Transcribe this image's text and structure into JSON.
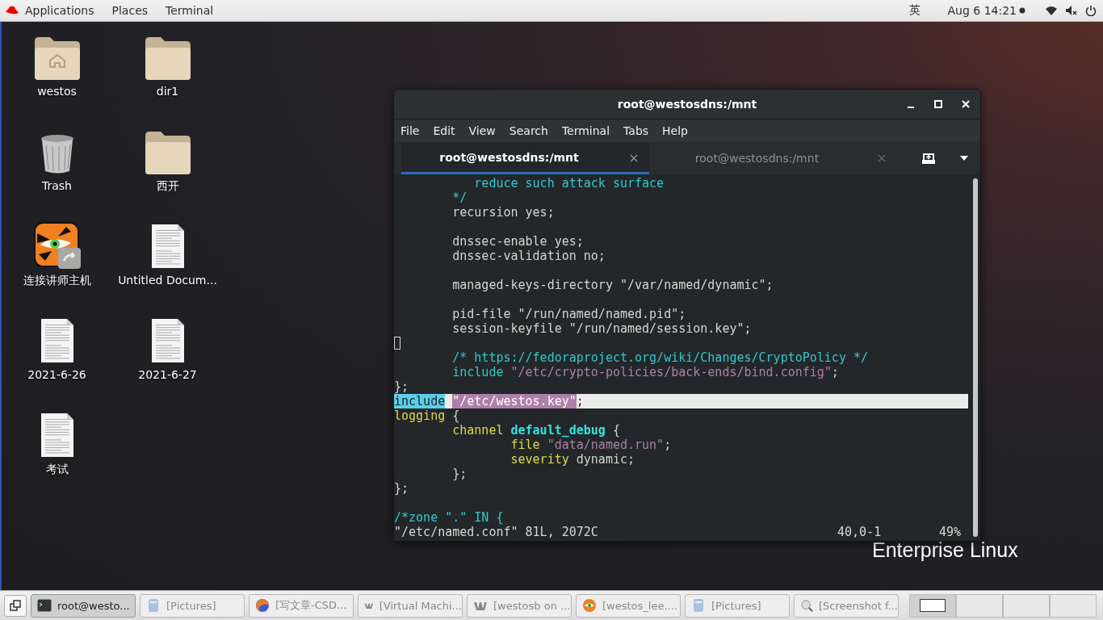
{
  "top_bar": {
    "menus": [
      {
        "label": "Applications"
      },
      {
        "label": "Places"
      },
      {
        "label": "Terminal"
      }
    ],
    "input_method": "英",
    "clock": "Aug 6  14:21"
  },
  "desktop": {
    "icons": [
      {
        "label": "westos",
        "kind": "home"
      },
      {
        "label": "dir1",
        "kind": "folder"
      },
      {
        "label": "Trash",
        "kind": "trash"
      },
      {
        "label": "西开",
        "kind": "folder"
      },
      {
        "label": "连接讲师主机",
        "kind": "app"
      },
      {
        "label": "Untitled Docum...",
        "kind": "document"
      },
      {
        "label": "2021-6-26",
        "kind": "document"
      },
      {
        "label": "2021-6-27",
        "kind": "document"
      },
      {
        "label": "考试",
        "kind": "document"
      }
    ],
    "wallpaper_text": "Enterprise Linux"
  },
  "window": {
    "title": "root@westosdns:/mnt",
    "menu": [
      "File",
      "Edit",
      "View",
      "Search",
      "Terminal",
      "Tabs",
      "Help"
    ],
    "tabs": [
      {
        "label": "root@westosdns:/mnt",
        "selected": true
      },
      {
        "label": "root@westosdns:/mnt",
        "selected": false
      }
    ],
    "lines": [
      {
        "segments": [
          {
            "text": "           reduce such attack surface",
            "kind": "comment"
          }
        ]
      },
      {
        "segments": [
          {
            "text": "        */",
            "kind": "comment"
          }
        ]
      },
      {
        "segments": [
          {
            "text": "        recursion yes;",
            "kind": "plain"
          }
        ]
      },
      {
        "kind": "blank"
      },
      {
        "segments": [
          {
            "text": "        dnssec-enable yes;",
            "kind": "plain"
          }
        ]
      },
      {
        "segments": [
          {
            "text": "        dnssec-validation no;",
            "kind": "plain"
          }
        ]
      },
      {
        "kind": "blank"
      },
      {
        "segments": [
          {
            "text": "        managed-keys-directory \"/var/named/dynamic\";",
            "kind": "plain"
          }
        ]
      },
      {
        "kind": "blank"
      },
      {
        "segments": [
          {
            "text": "        pid-file \"/run/named/named.pid\";",
            "kind": "plain"
          }
        ]
      },
      {
        "segments": [
          {
            "text": "        session-keyfile \"/run/named/session.key\";",
            "kind": "plain"
          }
        ]
      },
      {
        "kind": "cursor"
      },
      {
        "segments": [
          {
            "text": "        /* https://fedoraproject.org/wiki/Changes/CryptoPolicy */",
            "kind": "comment"
          }
        ]
      },
      {
        "segments": [
          {
            "text": "        include ",
            "kind": "comment"
          },
          {
            "text": "\"/etc/crypto-policies/back-ends/bind.config\"",
            "kind": "string"
          },
          {
            "text": ";",
            "kind": "plain"
          }
        ]
      },
      {
        "segments": [
          {
            "text": "};",
            "kind": "plain"
          }
        ]
      },
      {
        "kind": "current",
        "segments": [
          {
            "text": "include",
            "kind": "search-hit"
          },
          {
            "text": " \"/etc/westos.key\"",
            "kind": "match"
          },
          {
            "text": ";",
            "kind": "plain"
          }
        ]
      },
      {
        "segments": [
          {
            "text": "logging",
            "kind": "keyword"
          },
          {
            "text": " {",
            "kind": "plain"
          }
        ]
      },
      {
        "segments": [
          {
            "text": "        channel",
            "kind": "keyword"
          },
          {
            "text": " default_debug",
            "kind": "identifier"
          },
          {
            "text": " {",
            "kind": "plain"
          }
        ]
      },
      {
        "segments": [
          {
            "text": "                file",
            "kind": "keyword"
          },
          {
            "text": " \"data/named.run\"",
            "kind": "string"
          },
          {
            "text": ";",
            "kind": "plain"
          }
        ]
      },
      {
        "segments": [
          {
            "text": "                severity",
            "kind": "keyword"
          },
          {
            "text": " dynamic;",
            "kind": "plain"
          }
        ]
      },
      {
        "segments": [
          {
            "text": "        };",
            "kind": "plain"
          }
        ]
      },
      {
        "segments": [
          {
            "text": "};",
            "kind": "plain"
          }
        ]
      },
      {
        "kind": "blank"
      },
      {
        "segments": [
          {
            "text": "/*zone \".\" IN {",
            "kind": "comment"
          }
        ]
      }
    ],
    "status": {
      "file": "\"/etc/named.conf\" 81L, 2072C",
      "position": "40,0-1",
      "percent": "49%"
    }
  },
  "taskbar": {
    "items": [
      {
        "label": "root@westo...",
        "kind": "terminal",
        "selected": true
      },
      {
        "label": "[Pictures]",
        "kind": "files",
        "selected": false
      },
      {
        "label": "[写文章-CSD...",
        "kind": "browser",
        "selected": false
      },
      {
        "label": "[Virtual Machi...",
        "kind": "vm",
        "selected": false
      },
      {
        "label": "[westosb on ...",
        "kind": "vm",
        "selected": false
      },
      {
        "label": "[westos_lee....",
        "kind": "app",
        "selected": false
      },
      {
        "label": "[Pictures]",
        "kind": "files",
        "selected": false
      },
      {
        "label": "[Screenshot f...",
        "kind": "screenshot",
        "selected": false
      }
    ]
  }
}
